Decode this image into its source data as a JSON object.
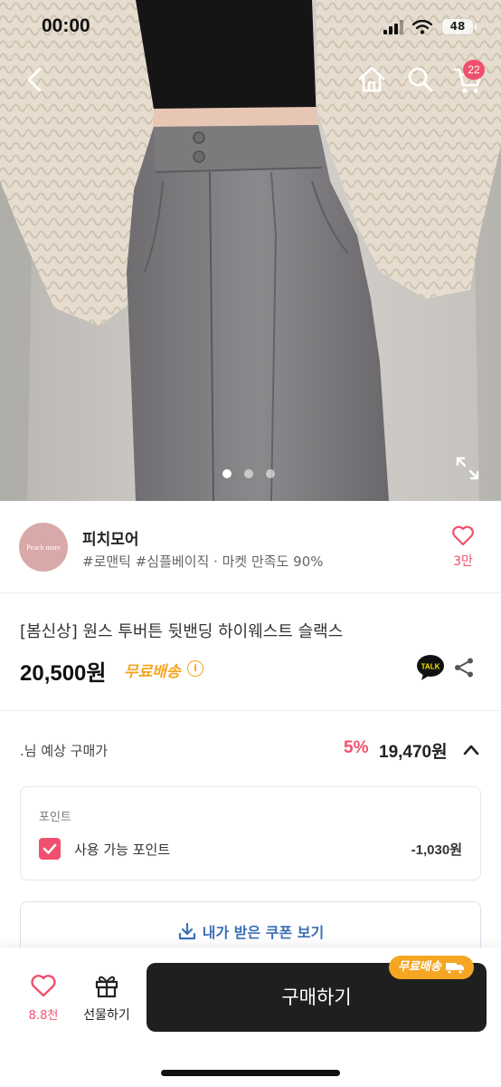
{
  "status_bar": {
    "time": "00:00",
    "battery": "48"
  },
  "nav": {
    "cart_count": "22"
  },
  "gallery": {
    "page_count": 3,
    "current_page": 1
  },
  "seller": {
    "logo_text": "Peach more",
    "name": "피치모어",
    "tags": "#로맨틱 #심플베이직 · 마켓 만족도 90%",
    "likes": "3만"
  },
  "product": {
    "title": "[봄신상] 원스 투버튼 뒷밴딩 하이웨스트 슬랙스",
    "price": "20,500원",
    "free_shipping": "무료배송",
    "talk_label": "TALK"
  },
  "expected": {
    "label": ".님 예상 구매가",
    "discount": "5%",
    "price": "19,470원"
  },
  "points": {
    "title": "포인트",
    "label": "사용 가능 포인트",
    "value": "-1,030원",
    "checked": true
  },
  "coupon": {
    "label": "내가 받은 쿠폰 보기"
  },
  "bottom": {
    "wish_count": "8.8천",
    "gift_label": "선물하기",
    "buy_label": "구매하기",
    "ship_badge": "무료배송"
  },
  "colors": {
    "accent": "#f0506e",
    "shipping": "#f5a623",
    "coupon": "#3b6fb6",
    "buy": "#1f1f1f"
  }
}
